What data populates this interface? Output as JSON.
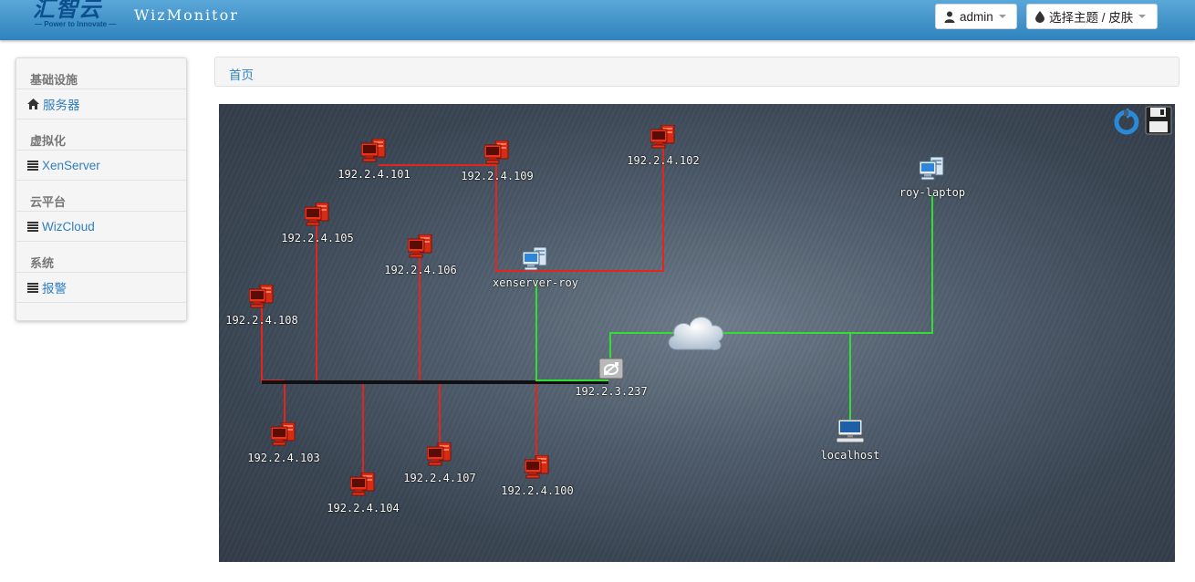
{
  "header": {
    "logo_text": "汇智云",
    "logo_tagline": "— Power to Innovate —",
    "brand": "WizMonitor",
    "user_label": "admin",
    "theme_label": "选择主题 / 皮肤"
  },
  "sidebar": {
    "sections": [
      {
        "header": "基础设施",
        "item": "服务器",
        "icon": "home-icon"
      },
      {
        "header": "虚拟化",
        "item": "XenServer",
        "icon": "list-icon"
      },
      {
        "header": "云平台",
        "item": "WizCloud",
        "icon": "list-icon"
      },
      {
        "header": "系统",
        "item": "报警",
        "icon": "list-icon"
      }
    ]
  },
  "breadcrumb": {
    "home": "首页"
  },
  "topology": {
    "toolbar": {
      "refresh_icon": "refresh-icon",
      "save_icon": "save-icon"
    },
    "nodes": [
      {
        "id": "n101",
        "label": "192.2.4.101",
        "type": "host-down"
      },
      {
        "id": "n109",
        "label": "192.2.4.109",
        "type": "host-down"
      },
      {
        "id": "n102",
        "label": "192.2.4.102",
        "type": "host-down"
      },
      {
        "id": "n105",
        "label": "192.2.4.105",
        "type": "host-down"
      },
      {
        "id": "n106",
        "label": "192.2.4.106",
        "type": "host-down"
      },
      {
        "id": "n108",
        "label": "192.2.4.108",
        "type": "host-down"
      },
      {
        "id": "n103",
        "label": "192.2.4.103",
        "type": "host-down"
      },
      {
        "id": "n107",
        "label": "192.2.4.107",
        "type": "host-down"
      },
      {
        "id": "n100",
        "label": "192.2.4.100",
        "type": "host-down"
      },
      {
        "id": "n104",
        "label": "192.2.4.104",
        "type": "host-down"
      },
      {
        "id": "xen",
        "label": "xenserver-roy",
        "type": "server-up"
      },
      {
        "id": "laptop",
        "label": "roy-laptop",
        "type": "server-up"
      },
      {
        "id": "switch",
        "label": "192.2.3.237",
        "type": "switch"
      },
      {
        "id": "localhost",
        "label": "localhost",
        "type": "workstation"
      },
      {
        "id": "cloud",
        "label": "",
        "type": "cloud"
      }
    ],
    "colors": {
      "down": "#e8231c",
      "up": "#33dd33",
      "bus": "#111111"
    }
  }
}
